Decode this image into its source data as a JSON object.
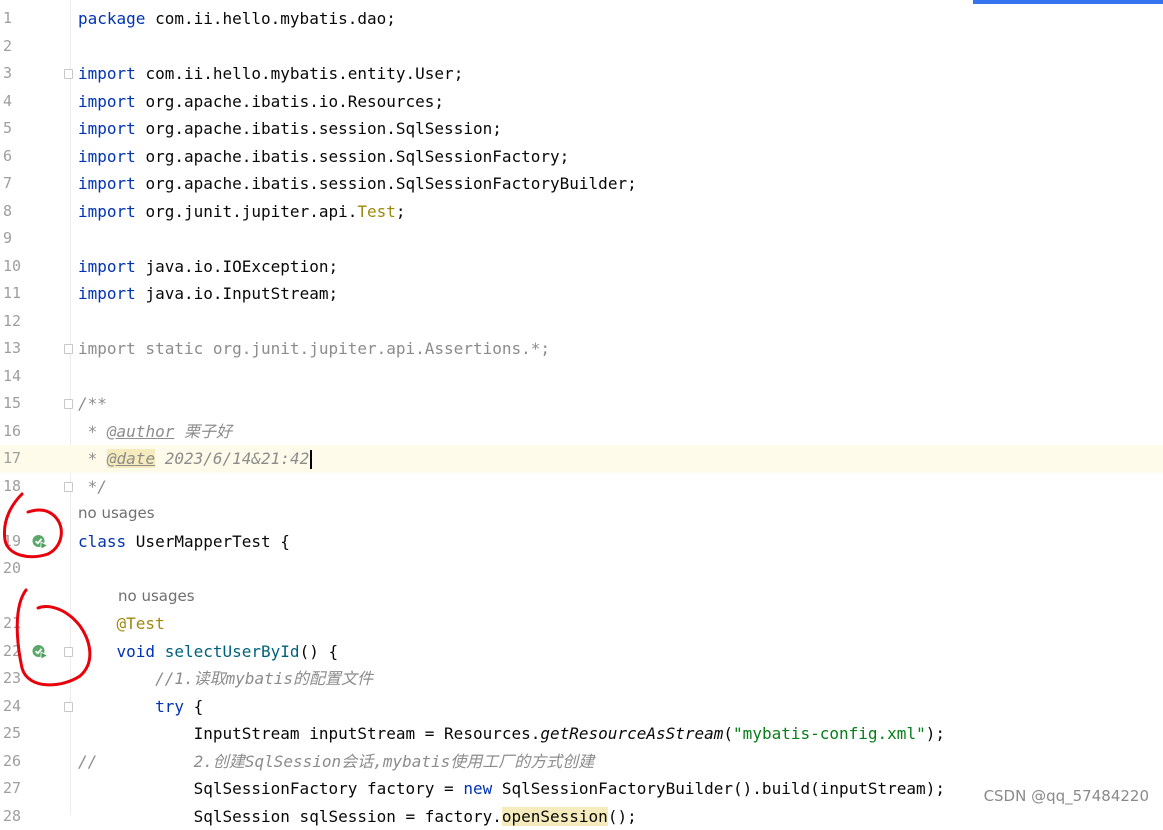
{
  "lines": [
    {
      "n": "1",
      "code": [
        {
          "t": "package ",
          "c": "kw"
        },
        {
          "t": "com.ii.hello.mybatis.dao;"
        }
      ]
    },
    {
      "n": "2",
      "code": []
    },
    {
      "n": "3",
      "fold": true,
      "code": [
        {
          "t": "import ",
          "c": "kw"
        },
        {
          "t": "com.ii.hello.mybatis.entity.User;"
        }
      ]
    },
    {
      "n": "4",
      "code": [
        {
          "t": "import ",
          "c": "kw"
        },
        {
          "t": "org.apache.ibatis.io.Resources;"
        }
      ]
    },
    {
      "n": "5",
      "code": [
        {
          "t": "import ",
          "c": "kw"
        },
        {
          "t": "org.apache.ibatis.session.SqlSession;"
        }
      ]
    },
    {
      "n": "6",
      "code": [
        {
          "t": "import ",
          "c": "kw"
        },
        {
          "t": "org.apache.ibatis.session.SqlSessionFactory;"
        }
      ]
    },
    {
      "n": "7",
      "code": [
        {
          "t": "import ",
          "c": "kw"
        },
        {
          "t": "org.apache.ibatis.session.SqlSessionFactoryBuilder;"
        }
      ]
    },
    {
      "n": "8",
      "code": [
        {
          "t": "import ",
          "c": "kw"
        },
        {
          "t": "org.junit.jupiter.api."
        },
        {
          "t": "Test",
          "c": "ann"
        },
        {
          "t": ";"
        }
      ]
    },
    {
      "n": "9",
      "code": []
    },
    {
      "n": "10",
      "code": [
        {
          "t": "import ",
          "c": "kw"
        },
        {
          "t": "java.io.IOException;"
        }
      ]
    },
    {
      "n": "11",
      "code": [
        {
          "t": "import ",
          "c": "kw"
        },
        {
          "t": "java.io.InputStream;"
        }
      ]
    },
    {
      "n": "12",
      "code": []
    },
    {
      "n": "13",
      "fold": true,
      "code": [
        {
          "t": "import static org.junit.jupiter.api.Assertions.*;",
          "c": "gray"
        }
      ]
    },
    {
      "n": "14",
      "code": []
    },
    {
      "n": "15",
      "fold": true,
      "code": [
        {
          "t": "/**",
          "c": "doc"
        }
      ]
    },
    {
      "n": "16",
      "code": [
        {
          "t": " * ",
          "c": "doc"
        },
        {
          "t": "@author",
          "c": "doctag"
        },
        {
          "t": " 栗子好",
          "c": "doc"
        }
      ]
    },
    {
      "n": "17",
      "hl": true,
      "caret": true,
      "code": [
        {
          "t": " * ",
          "c": "doc"
        },
        {
          "t": "@date",
          "c": "doctag sel"
        },
        {
          "t": " 2023/6/14&21:42",
          "c": "doc"
        }
      ]
    },
    {
      "n": "18",
      "fold": true,
      "code": [
        {
          "t": " */",
          "c": "doc"
        }
      ]
    },
    {
      "hint": "no usages",
      "indent": 78
    },
    {
      "n": "19",
      "run": true,
      "code": [
        {
          "t": "class ",
          "c": "kw"
        },
        {
          "t": "UserMapperTest {"
        }
      ]
    },
    {
      "n": "20",
      "code": []
    },
    {
      "hint": "no usages",
      "indent": 118
    },
    {
      "n": "21",
      "code": [
        {
          "t": "    "
        },
        {
          "t": "@Test",
          "c": "ann"
        }
      ]
    },
    {
      "n": "22",
      "run": true,
      "fold": true,
      "code": [
        {
          "t": "    "
        },
        {
          "t": "void ",
          "c": "kw"
        },
        {
          "t": "selectUserById",
          "c": "fn"
        },
        {
          "t": "() {"
        }
      ]
    },
    {
      "n": "23",
      "code": [
        {
          "t": "        "
        },
        {
          "t": "//1.读取mybatis的配置文件",
          "c": "com"
        }
      ]
    },
    {
      "n": "24",
      "fold": true,
      "code": [
        {
          "t": "        "
        },
        {
          "t": "try ",
          "c": "kw"
        },
        {
          "t": "{"
        }
      ]
    },
    {
      "n": "25",
      "code": [
        {
          "t": "            InputStream inputStream = Resources."
        },
        {
          "t": "getResourceAsStream",
          "c": "static-fn"
        },
        {
          "t": "("
        },
        {
          "t": "\"mybatis-config.xml\"",
          "c": "str"
        },
        {
          "t": ");"
        }
      ]
    },
    {
      "n": "26",
      "code": [
        {
          "t": "//          2.创建SqlSession会话,mybatis使用工厂的方式创建",
          "c": "com"
        }
      ]
    },
    {
      "n": "27",
      "code": [
        {
          "t": "            SqlSessionFactory factory = "
        },
        {
          "t": "new ",
          "c": "kw"
        },
        {
          "t": "SqlSessionFactoryBuilder().build(inputStream);"
        }
      ]
    },
    {
      "n": "28",
      "code": [
        {
          "t": "            SqlSession sqlSession = factory."
        },
        {
          "t": "openSession",
          "c": "hlbg"
        },
        {
          "t": "();"
        }
      ]
    }
  ],
  "watermark": "CSDN @qq_57484220",
  "icons": {
    "run": "run-test-icon",
    "fold": "fold-marker-icon"
  },
  "colors": {
    "keyword": "#0033b3",
    "annotation": "#9e880d",
    "string": "#067d17",
    "comment": "#8c8c8c",
    "method": "#00627a",
    "annotation_marker": "#e8000b"
  }
}
